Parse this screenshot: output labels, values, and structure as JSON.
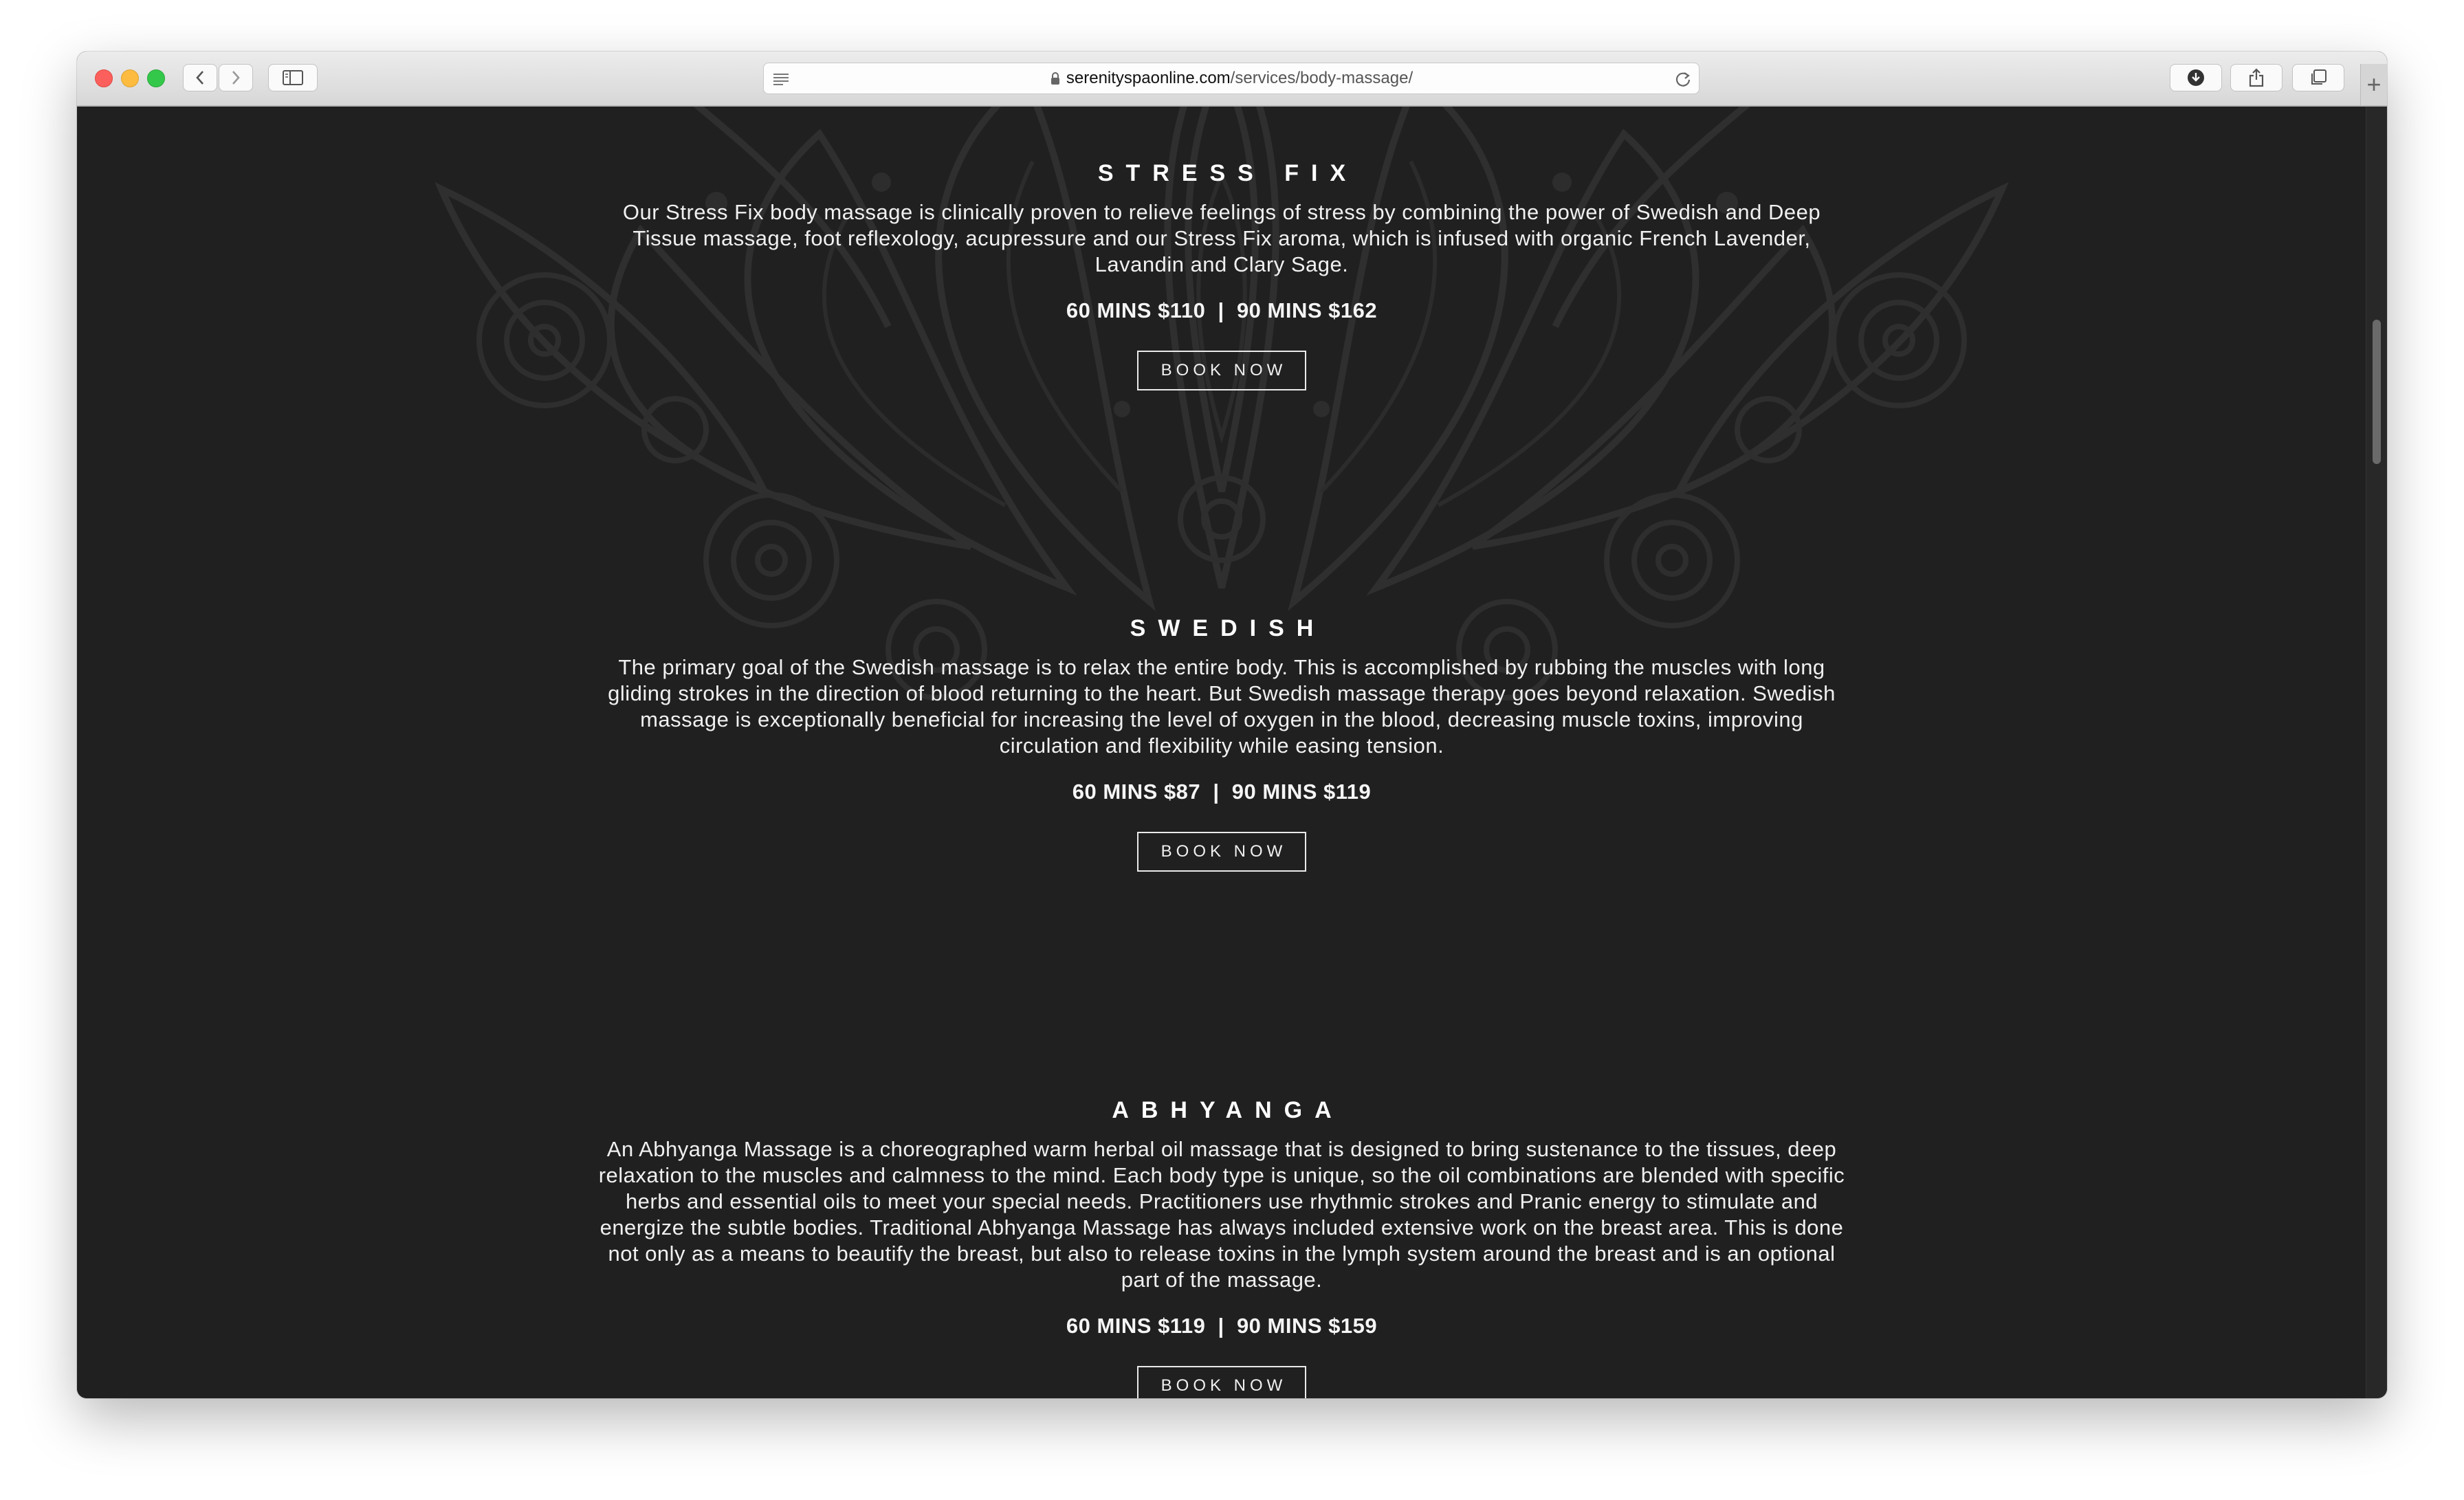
{
  "browser": {
    "url_host": "serenityspaonline.com",
    "url_path": "/services/body-massage/",
    "new_tab_symbol": "+"
  },
  "services": [
    {
      "title": "STRESS FIX",
      "description": "Our Stress Fix body massage is clinically proven to relieve feelings of stress by combining the power of Swedish and Deep Tissue massage, foot reflexology, acupressure and our Stress Fix aroma, which is infused with organic French Lavender, Lavandin and Clary Sage.",
      "price": "60 MINS $110  |  90 MINS $162",
      "button_label": "BOOK NOW"
    },
    {
      "title": "SWEDISH",
      "description": "The primary goal of the Swedish massage is to relax the entire body. This is accomplished by rubbing the muscles with long gliding strokes in the direction of blood returning to the heart. But Swedish massage therapy goes beyond relaxation. Swedish massage is exceptionally beneficial for increasing the level of oxygen in the blood, decreasing muscle toxins, improving circulation and flexibility while easing tension.",
      "price": "60 MINS $87  |  90 MINS $119",
      "button_label": "BOOK NOW"
    },
    {
      "title": "ABHYANGA",
      "description": "An Abhyanga Massage is a choreographed warm herbal oil massage that is designed to bring sustenance to the tissues, deep relaxation to the muscles and calmness to the mind. Each body type is unique, so the oil combinations are blended with specific herbs and essential oils to meet your special needs. Practitioners use rhythmic strokes and Pranic energy to stimulate and energize the subtle bodies. Traditional Abhyanga Massage has always included extensive work on the breast area. This is done not only as a means to beautify the breast, but also to release toxins in the lymph system around the breast and is an optional part of the massage.",
      "price": "60 MINS $119  |  90 MINS $159",
      "button_label": "BOOK NOW"
    }
  ],
  "colors": {
    "page_background": "#202020",
    "text": "#f2f2f2"
  }
}
